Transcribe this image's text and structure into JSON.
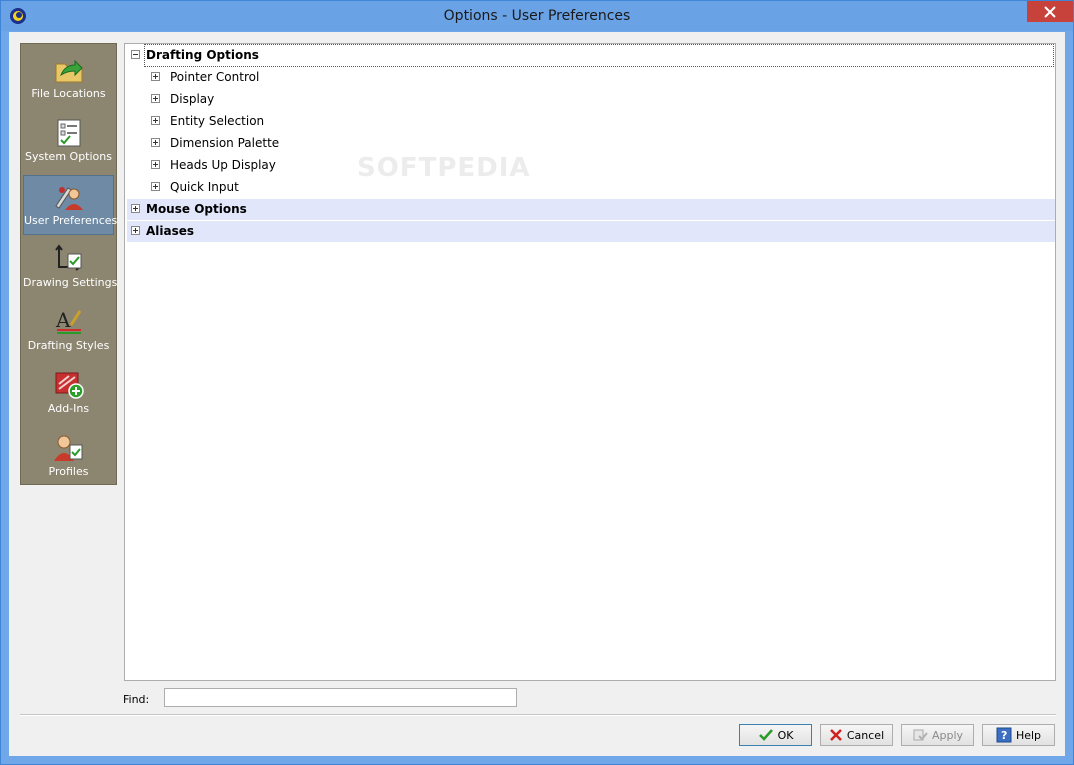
{
  "window": {
    "title": "Options - User Preferences"
  },
  "sidebar": {
    "items": [
      {
        "label": "File Locations",
        "icon": "folder-arrow-icon",
        "active": false
      },
      {
        "label": "System Options",
        "icon": "checklist-icon",
        "active": false
      },
      {
        "label": "User Preferences",
        "icon": "user-tools-icon",
        "active": true
      },
      {
        "label": "Drawing Settings",
        "icon": "axes-check-icon",
        "active": false
      },
      {
        "label": "Drafting Styles",
        "icon": "text-style-icon",
        "active": false
      },
      {
        "label": "Add-Ins",
        "icon": "addin-plus-icon",
        "active": false
      },
      {
        "label": "Profiles",
        "icon": "user-profile-icon",
        "active": false
      }
    ]
  },
  "tree": {
    "groups": [
      {
        "label": "Drafting Options",
        "expanded": true,
        "children": [
          {
            "label": "Pointer Control"
          },
          {
            "label": "Display"
          },
          {
            "label": "Entity Selection"
          },
          {
            "label": "Dimension Palette"
          },
          {
            "label": "Heads Up Display"
          },
          {
            "label": "Quick Input"
          }
        ]
      },
      {
        "label": "Mouse Options",
        "expanded": false
      },
      {
        "label": "Aliases",
        "expanded": false
      }
    ]
  },
  "watermark": "SOFTPEDIA",
  "find": {
    "label": "Find:",
    "value": ""
  },
  "buttons": {
    "ok": "OK",
    "cancel": "Cancel",
    "apply": "Apply",
    "help": "Help"
  },
  "colors": {
    "titlebar": "#6aa2e6",
    "sidebar": "#8c8671",
    "active_item": "#6e8aa4",
    "group_row": "#e1e6fb",
    "close": "#c7423a"
  }
}
